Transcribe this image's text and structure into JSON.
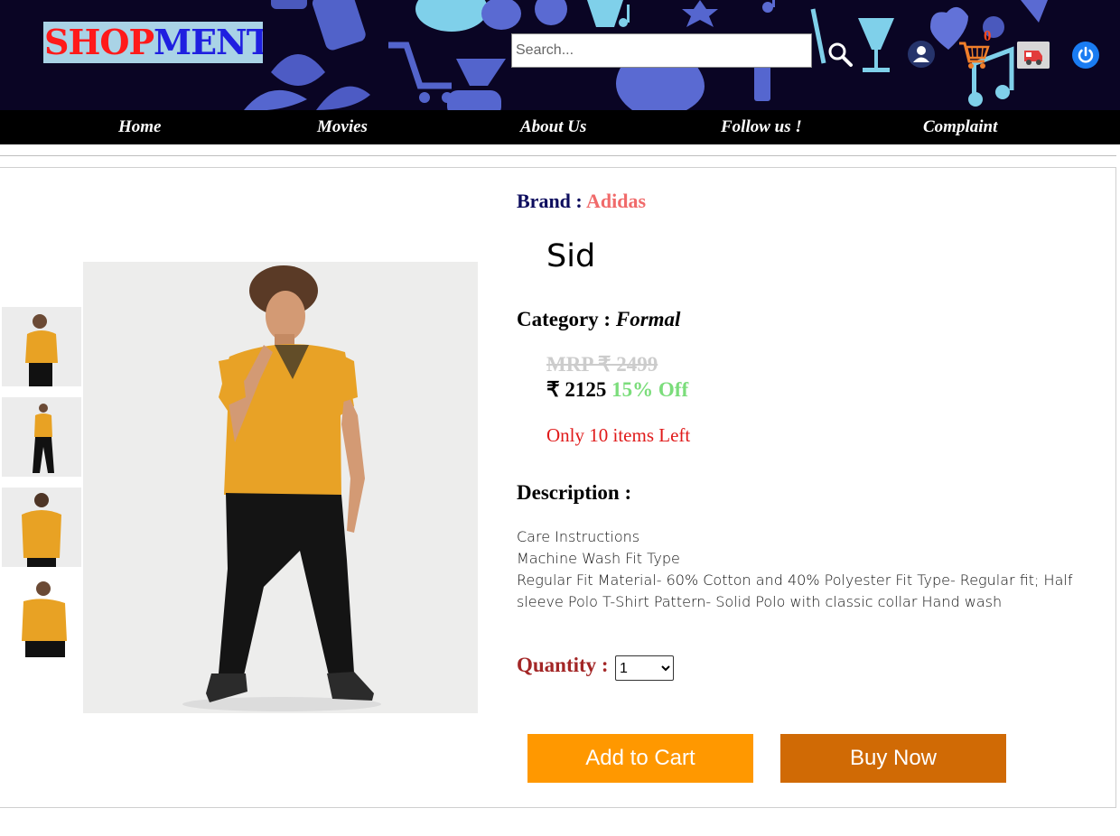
{
  "header": {
    "logo_part1": "SHOP",
    "logo_part2": "MENT",
    "search_placeholder": "Search...",
    "cart_count": "0",
    "icons": [
      "search-icon",
      "user-icon",
      "cart-icon",
      "orders-icon",
      "power-icon"
    ]
  },
  "nav": {
    "items": [
      {
        "label": "Home"
      },
      {
        "label": "Movies"
      },
      {
        "label": "About Us"
      },
      {
        "label": "Follow us !"
      },
      {
        "label": "Complaint"
      }
    ]
  },
  "product": {
    "brand_label": "Brand :",
    "brand": "Adidas",
    "name": "Sid",
    "category_label": "Category :",
    "category": "Formal",
    "mrp": "MRP ₹ 2499",
    "price": "₹ 2125",
    "discount": "15% Off",
    "stock": "Only 10 items Left",
    "description_label": "Description :",
    "description_lines": [
      "Care Instructions",
      "Machine Wash Fit Type",
      "Regular Fit Material- 60% Cotton and 40% Polyester Fit Type- Regular fit; Half sleeve Polo T-Shirt Pattern- Solid Polo with classic collar Hand wash"
    ],
    "quantity_label": "Quantity :",
    "quantity_selected": "1",
    "add_to_cart": "Add to Cart",
    "buy_now": "Buy Now"
  },
  "colors": {
    "header_bg": "#0a0524",
    "nav_bg": "#000000",
    "brand_value": "#f06a6a",
    "discount": "#7bdd7b",
    "stock": "#e01a1a",
    "quantity_label": "#a32626",
    "add_to_cart_bg": "#ff9800",
    "buy_now_bg": "#d06a05"
  }
}
